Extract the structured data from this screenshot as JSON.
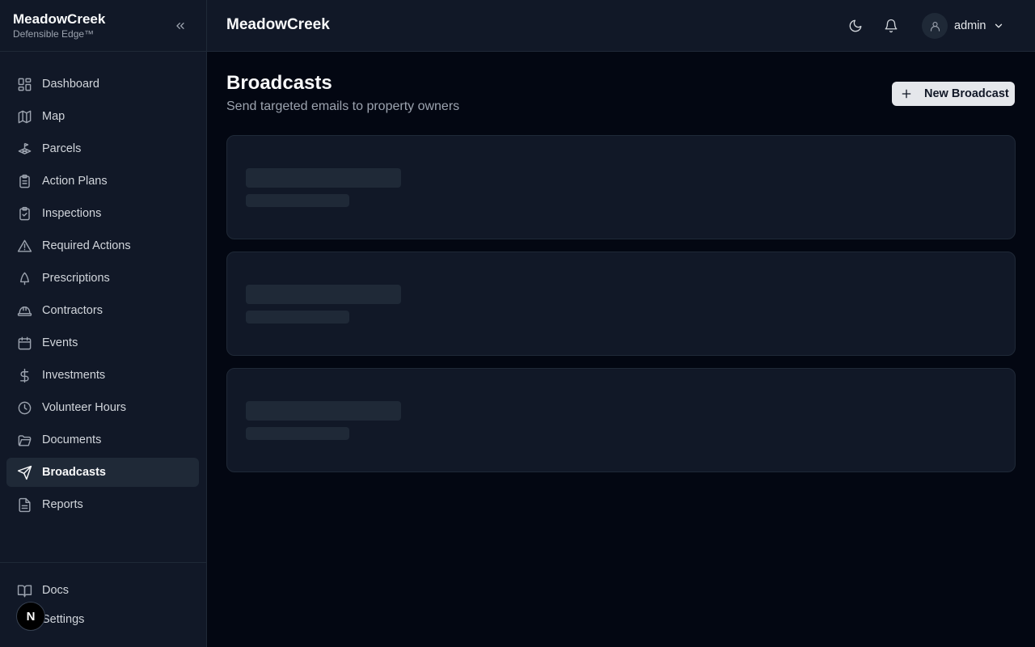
{
  "sidebar": {
    "brand_name": "MeadowCreek",
    "brand_sub": "Defensible Edge™",
    "items": [
      {
        "label": "Dashboard",
        "icon": "dashboard-icon"
      },
      {
        "label": "Map",
        "icon": "map-icon"
      },
      {
        "label": "Parcels",
        "icon": "parcels-icon"
      },
      {
        "label": "Action Plans",
        "icon": "clipboard-icon"
      },
      {
        "label": "Inspections",
        "icon": "clipboard-check-icon"
      },
      {
        "label": "Required Actions",
        "icon": "warning-icon"
      },
      {
        "label": "Prescriptions",
        "icon": "tree-icon"
      },
      {
        "label": "Contractors",
        "icon": "hard-hat-icon"
      },
      {
        "label": "Events",
        "icon": "calendar-icon"
      },
      {
        "label": "Investments",
        "icon": "dollar-icon"
      },
      {
        "label": "Volunteer Hours",
        "icon": "clock-icon"
      },
      {
        "label": "Documents",
        "icon": "folder-icon"
      },
      {
        "label": "Broadcasts",
        "icon": "send-icon"
      },
      {
        "label": "Reports",
        "icon": "file-text-icon"
      }
    ],
    "active_item": "Broadcasts",
    "bottom_items": [
      {
        "label": "Docs",
        "icon": "book-icon"
      },
      {
        "label": "Settings",
        "icon": "gear-icon"
      }
    ],
    "badge_letter": "N"
  },
  "header": {
    "title": "MeadowCreek",
    "user_name": "admin"
  },
  "main": {
    "title": "Broadcasts",
    "subtitle": "Send targeted emails to property owners",
    "new_button_label": "New Broadcast"
  },
  "colors": {
    "background": "#030712",
    "panel": "#111827",
    "border": "#1f2937",
    "skeleton": "#1f2937",
    "button_bg": "#e5e7eb"
  }
}
